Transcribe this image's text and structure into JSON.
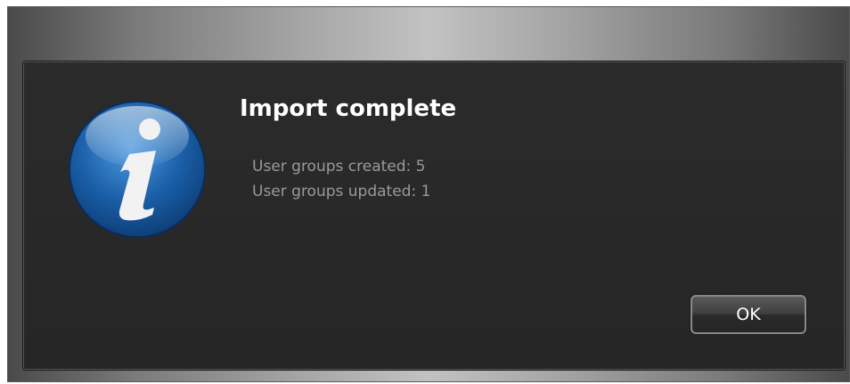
{
  "dialog": {
    "icon": "info-icon",
    "title": "Import complete",
    "messages": [
      "User groups created: 5",
      "User groups updated: 1"
    ],
    "ok_label": "OK"
  },
  "colors": {
    "dialog_background": "#262626",
    "title_text": "#ffffff",
    "message_text": "#9a9a9a",
    "icon_blue": "#1a5fa8"
  }
}
